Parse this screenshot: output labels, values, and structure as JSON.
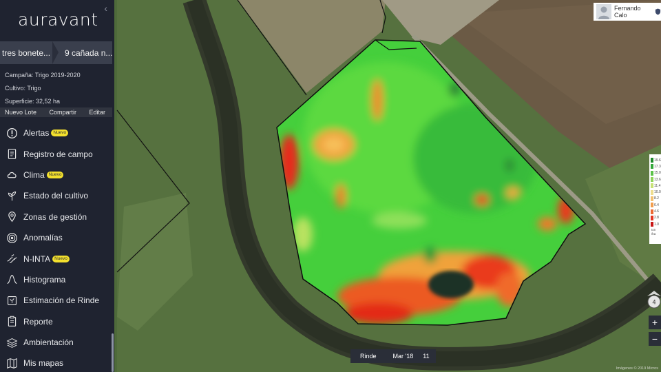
{
  "app": {
    "logo": "auravant"
  },
  "breadcrumb": [
    "tres bonete...",
    "9 cañada n..."
  ],
  "lot_info": {
    "campaign": "Campaña: Trigo 2019-2020",
    "crop": "Cultivo: Trigo",
    "surface": "Superficie: 32,52 ha"
  },
  "actions": {
    "new_lot": "Nuevo Lote",
    "share": "Compartir",
    "edit": "Editar"
  },
  "menu": [
    {
      "label": "Alertas",
      "badge": "Nuevo",
      "icon": "alert-icon"
    },
    {
      "label": "Registro de campo",
      "badge": "",
      "icon": "field-record-icon"
    },
    {
      "label": "Clima",
      "badge": "Nuevo",
      "icon": "cloud-icon"
    },
    {
      "label": "Estado del cultivo",
      "badge": "",
      "icon": "plant-icon"
    },
    {
      "label": "Zonas de gestión",
      "badge": "",
      "icon": "map-pin-icon"
    },
    {
      "label": "Anomalías",
      "badge": "",
      "icon": "anomaly-icon"
    },
    {
      "label": "N-INTA",
      "badge": "Nuevo",
      "icon": "nitrogen-icon"
    },
    {
      "label": "Histograma",
      "badge": "",
      "icon": "histogram-icon"
    },
    {
      "label": "Estimación de Rinde",
      "badge": "",
      "icon": "yield-estimate-icon"
    },
    {
      "label": "Reporte",
      "badge": "",
      "icon": "report-icon"
    },
    {
      "label": "Ambientación",
      "badge": "",
      "icon": "layers-icon"
    },
    {
      "label": "Mis mapas",
      "badge": "",
      "icon": "my-maps-icon"
    }
  ],
  "user": {
    "name": "Fernando Calo"
  },
  "legend": {
    "items": [
      {
        "label": "19.6",
        "color": "#1f8a2c"
      },
      {
        "label": "17.3",
        "color": "#33a83a"
      },
      {
        "label": "15.0",
        "color": "#5cc24a"
      },
      {
        "label": "13.6",
        "color": "#8fd35a"
      },
      {
        "label": "11.4",
        "color": "#c8e277"
      },
      {
        "label": "10.0",
        "color": "#eedd8e"
      },
      {
        "label": "8.2",
        "color": "#f3c071"
      },
      {
        "label": "6.4",
        "color": "#f29e4e"
      },
      {
        "label": "4.6",
        "color": "#ec6a34"
      },
      {
        "label": "2.8",
        "color": "#e33522"
      },
      {
        "label": "1.0",
        "color": "#c81515"
      }
    ],
    "unit1": "ton",
    "unit2": "/ha"
  },
  "compass": {
    "label": "4"
  },
  "zoom": {
    "in": "+",
    "out": "−"
  },
  "bottom_bar": {
    "layer": "Rinde",
    "date": "Mar '18",
    "count": "11"
  },
  "attribution": "Imágenes © 2019 Micros",
  "colors": {
    "sidebar_bg": "#1f2330",
    "badge": "#f3e02d",
    "accent_green": "#4cd137"
  }
}
